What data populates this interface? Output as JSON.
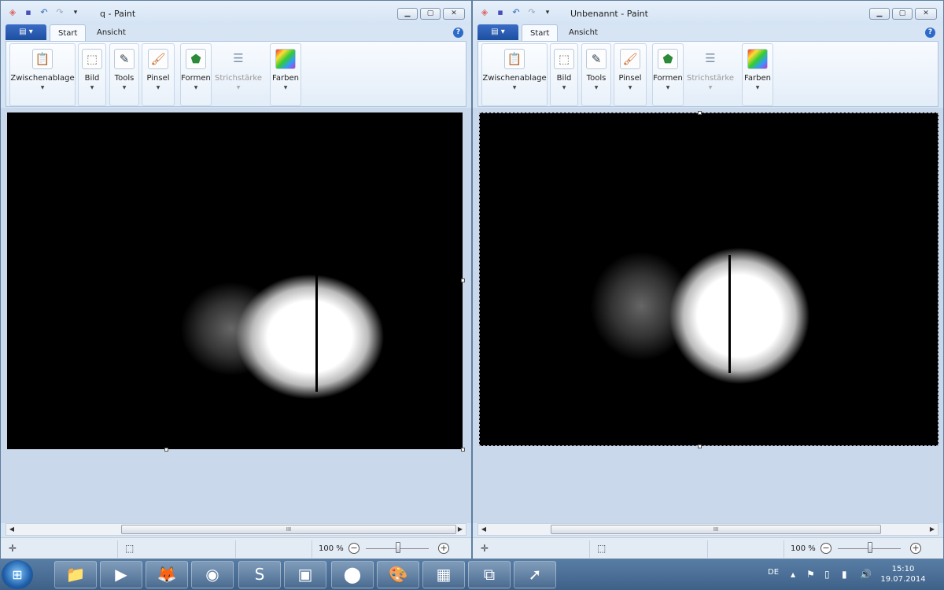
{
  "left_window": {
    "title": "q - Paint",
    "tabs": [
      "Start",
      "Ansicht"
    ],
    "groups": [
      "Zwischenablage",
      "Bild",
      "Tools",
      "Pinsel",
      "Formen",
      "Strichstärke",
      "Farben"
    ],
    "zoom": "100 %"
  },
  "right_window": {
    "title": "Unbenannt - Paint",
    "tabs": [
      "Start",
      "Ansicht"
    ],
    "groups": [
      "Zwischenablage",
      "Bild",
      "Tools",
      "Pinsel",
      "Formen",
      "Strichstärke",
      "Farben"
    ],
    "zoom": "100 %"
  },
  "common": {
    "file_menu_glyph": "▤ ▾",
    "help_glyph": "?",
    "scroll_thumb_glyph": "III",
    "minimize": "▁",
    "maximize": "▢",
    "close": "✕"
  },
  "taskbar": {
    "start_glyph": "⊞",
    "buttons": [
      {
        "icon": "explorer-icon",
        "glyph": "📁"
      },
      {
        "icon": "media-player-icon",
        "glyph": "▶"
      },
      {
        "icon": "firefox-icon",
        "glyph": "🦊"
      },
      {
        "icon": "chrome-icon",
        "glyph": "◉"
      },
      {
        "icon": "skype-icon",
        "glyph": "S"
      },
      {
        "icon": "document-icon",
        "glyph": "▣"
      },
      {
        "icon": "recorder-icon",
        "glyph": "⬤"
      },
      {
        "icon": "paint-icon",
        "glyph": "🎨"
      },
      {
        "icon": "monitor-icon",
        "glyph": "▦"
      },
      {
        "icon": "windows-explorer-icon",
        "glyph": "⧉"
      },
      {
        "icon": "cursor-icon",
        "glyph": "➚"
      }
    ],
    "language": "DE",
    "time": "15:10",
    "date": "19.07.2014"
  },
  "colors": {
    "canvas_bg": "#000000",
    "workspace": "#c9d8ea",
    "taskbar": "#4a6f98"
  }
}
